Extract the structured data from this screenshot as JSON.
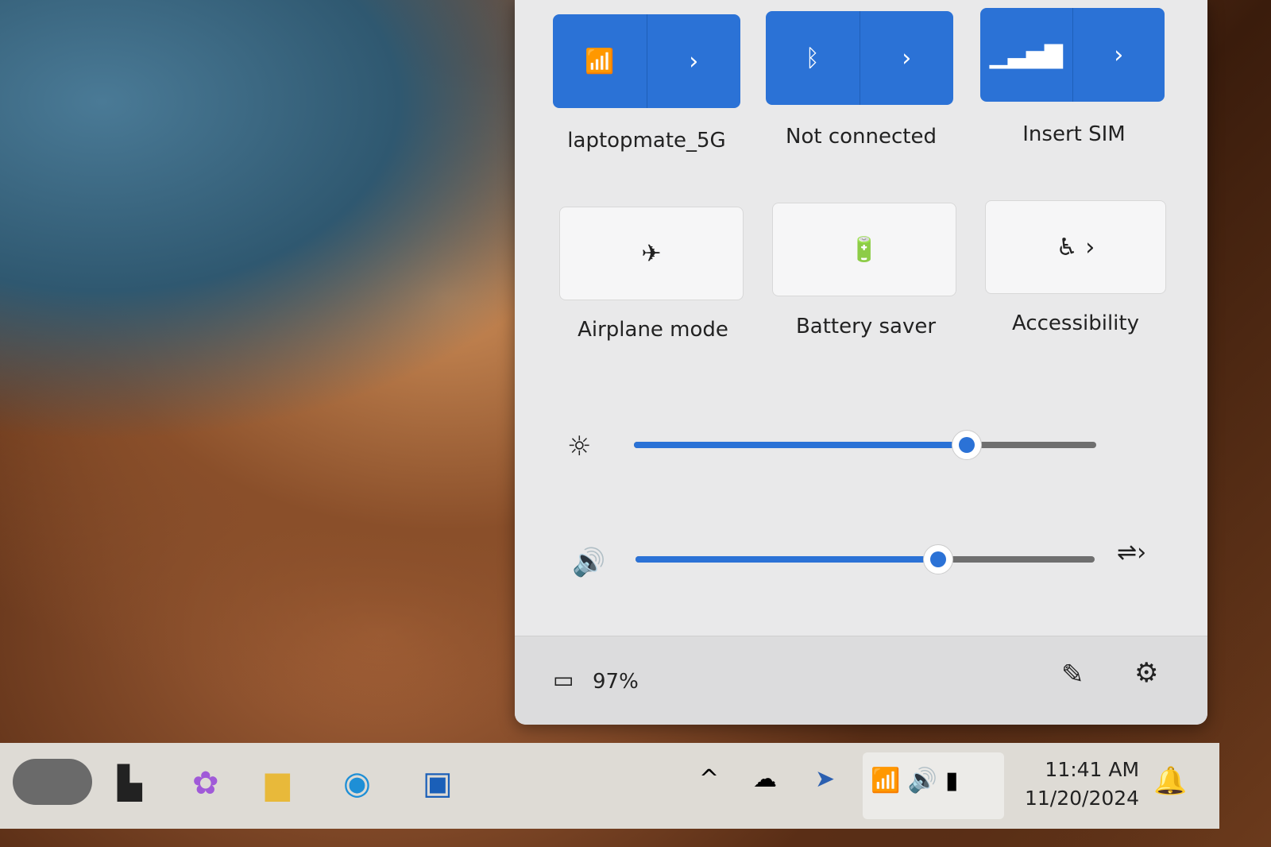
{
  "quick_settings": {
    "tiles": [
      {
        "label": "laptopmate_5G",
        "icon": "wifi-icon",
        "active": true
      },
      {
        "label": "Not connected",
        "icon": "bluetooth-icon",
        "active": true
      },
      {
        "label": "Insert SIM",
        "icon": "cellular-icon",
        "active": true
      },
      {
        "label": "Airplane mode",
        "icon": "airplane-icon",
        "active": false
      },
      {
        "label": "Battery saver",
        "icon": "battery-saver-icon",
        "active": false
      },
      {
        "label": "Accessibility",
        "icon": "accessibility-icon",
        "active": false
      }
    ],
    "brightness": 0.72,
    "volume": 0.66,
    "battery": "97%",
    "accent": "#2b72d6"
  },
  "taskbar": {
    "time": "11:41 AM",
    "date": "11/20/2024",
    "apps": [
      "widgets",
      "task-view",
      "copilot",
      "file-explorer",
      "edge",
      "store"
    ]
  }
}
